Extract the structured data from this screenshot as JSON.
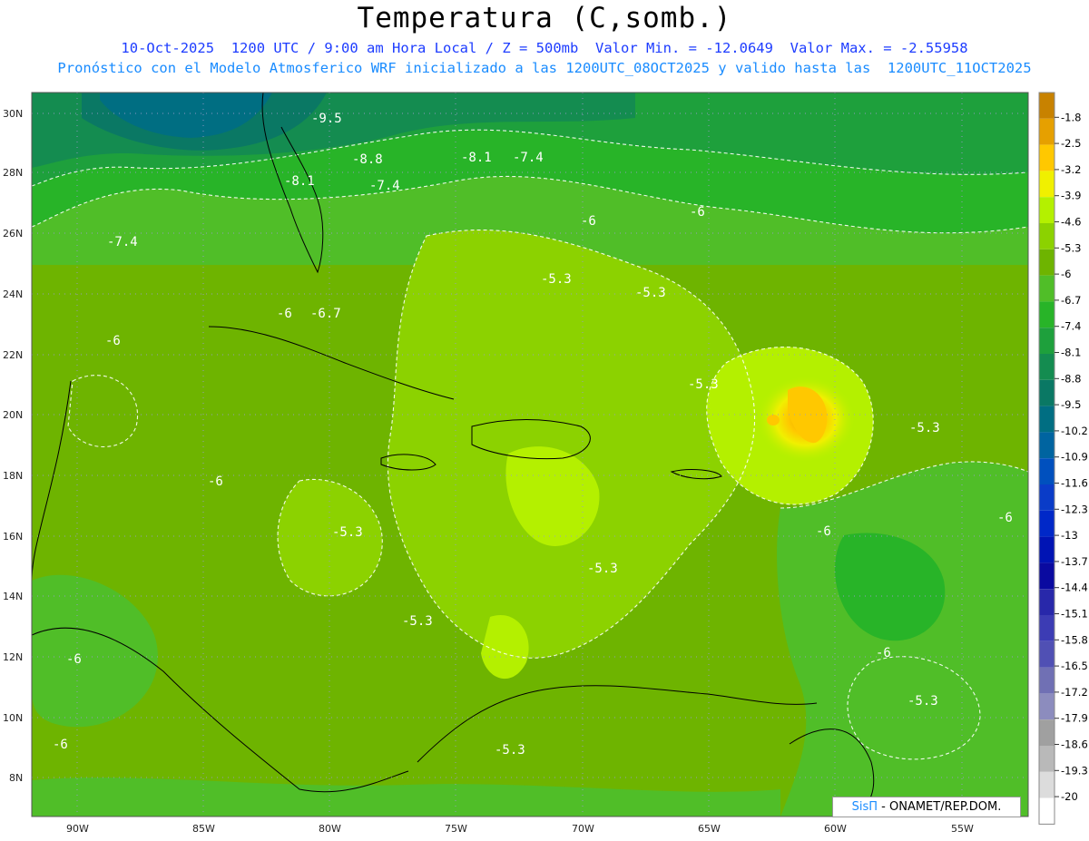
{
  "header": {
    "title": "Temperatura (C,somb.)",
    "line1": "10-Oct-2025  1200 UTC / 9:00 am Hora Local / Z = 500mb  Valor Min. = -12.0649  Valor Max. = -2.55958",
    "line2": "Pronóstico con el Modelo Atmosferico WRF inicializado a las 1200UTC_08OCT2025 y valido hasta las  1200UTC_11OCT2025"
  },
  "axes": {
    "lat_labels": [
      "30N",
      "28N",
      "26N",
      "24N",
      "22N",
      "20N",
      "18N",
      "16N",
      "14N",
      "12N",
      "10N",
      "8N"
    ],
    "lon_labels": [
      "90W",
      "85W",
      "80W",
      "75W",
      "70W",
      "65W",
      "60W",
      "55W"
    ]
  },
  "contour_labels": [
    "-9.5",
    "-8.8",
    "-8.1",
    "-7.4",
    "-8.1",
    "-7.4",
    "-7.4",
    "-6",
    "-6",
    "-6.7",
    "-6",
    "-5.3",
    "-5.3",
    "-5.3",
    "-5.3",
    "-6",
    "-5.3",
    "-6",
    "-5.3",
    "-5.3",
    "-6",
    "-6",
    "-5.3",
    "-6",
    "-6",
    "-6",
    "-5.3"
  ],
  "colorbar": {
    "labels": [
      "-1.8",
      "-2.5",
      "-3.2",
      "-3.9",
      "-4.6",
      "-5.3",
      "-6",
      "-6.7",
      "-7.4",
      "-8.1",
      "-8.8",
      "-9.5",
      "-10.2",
      "-10.9",
      "-11.6",
      "-12.3",
      "-13",
      "-13.7",
      "-14.4",
      "-15.1",
      "-15.8",
      "-16.5",
      "-17.2",
      "-17.9",
      "-18.6",
      "-19.3",
      "-20"
    ],
    "colors": [
      "#c88200",
      "#e6a000",
      "#ffc800",
      "#f0f000",
      "#b4f000",
      "#8cd200",
      "#6eb400",
      "#50be28",
      "#28b428",
      "#1ea03c",
      "#148c50",
      "#0a7864",
      "#006e82",
      "#0064a0",
      "#0050be",
      "#0a3cc8",
      "#0028c8",
      "#0014b4",
      "#0a0aa0",
      "#2828aa",
      "#3c3cb4",
      "#5050b4",
      "#7070b4",
      "#8c8cbe",
      "#a0a0a0",
      "#b9b9b9",
      "#dcdcdc",
      "#ffffff"
    ]
  },
  "credit": {
    "brand": "SisΠ",
    "text": "- ONAMET/REP.DOM."
  }
}
